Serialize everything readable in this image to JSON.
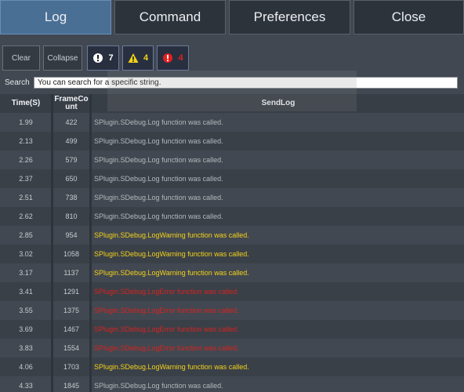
{
  "tabs": {
    "log": "Log",
    "command": "Command",
    "preferences": "Preferences",
    "close": "Close"
  },
  "toolbar": {
    "clear": "Clear",
    "collapse": "Collapse",
    "info_count": "7",
    "warning_count": "4",
    "error_count": "4",
    "info_color": "#ffffff",
    "warning_color": "#f2d21a",
    "error_color": "#e41e1e"
  },
  "search": {
    "label": "Search",
    "value": "You can search for a specific string."
  },
  "table": {
    "headers": {
      "time": "Time(S)",
      "frame_line1": "FrameCo",
      "frame_line2": "unt",
      "log": "SendLog"
    },
    "level_colors": {
      "log": "#b4b8bd",
      "warning": "#f2d21a",
      "error": "#d8221f"
    },
    "rows": [
      {
        "time": "1.99",
        "frame": "422",
        "level": "log",
        "message": "SPlugin.SDebug.Log function was called."
      },
      {
        "time": "2.13",
        "frame": "499",
        "level": "log",
        "message": "SPlugin.SDebug.Log function was called."
      },
      {
        "time": "2.26",
        "frame": "579",
        "level": "log",
        "message": "SPlugin.SDebug.Log function was called."
      },
      {
        "time": "2.37",
        "frame": "650",
        "level": "log",
        "message": "SPlugin.SDebug.Log function was called."
      },
      {
        "time": "2.51",
        "frame": "738",
        "level": "log",
        "message": "SPlugin.SDebug.Log function was called."
      },
      {
        "time": "2.62",
        "frame": "810",
        "level": "log",
        "message": "SPlugin.SDebug.Log function was called."
      },
      {
        "time": "2.85",
        "frame": "954",
        "level": "warning",
        "message": "SPlugin.SDebug.LogWarning function was called."
      },
      {
        "time": "3.02",
        "frame": "1058",
        "level": "warning",
        "message": "SPlugin.SDebug.LogWarning function was called."
      },
      {
        "time": "3.17",
        "frame": "1137",
        "level": "warning",
        "message": "SPlugin.SDebug.LogWarning function was called."
      },
      {
        "time": "3.41",
        "frame": "1291",
        "level": "error",
        "message": "SPlugin.SDebug.LogError function was called."
      },
      {
        "time": "3.55",
        "frame": "1375",
        "level": "error",
        "message": "SPlugin.SDebug.LogError function was called."
      },
      {
        "time": "3.69",
        "frame": "1467",
        "level": "error",
        "message": "SPlugin.SDebug.LogError function was called."
      },
      {
        "time": "3.83",
        "frame": "1554",
        "level": "error",
        "message": "SPlugin.SDebug.LogError function was called."
      },
      {
        "time": "4.06",
        "frame": "1703",
        "level": "warning",
        "message": "SPlugin.SDebug.LogWarning function was called."
      },
      {
        "time": "4.33",
        "frame": "1845",
        "level": "log",
        "message": "SPlugin.SDebug.Log function was called."
      }
    ]
  }
}
